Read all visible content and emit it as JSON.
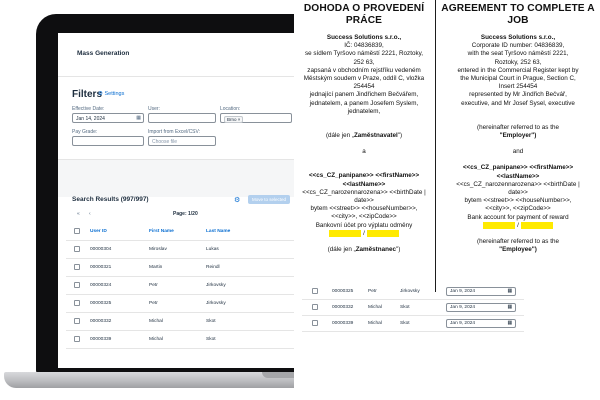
{
  "app": {
    "title": "Mass Generation",
    "filters_title": "Filters",
    "settings_label": "Settings",
    "fields": {
      "effective_date": {
        "label": "Effective Date:",
        "value": "Jan 14, 2024"
      },
      "user": {
        "label": "User:",
        "value": ""
      },
      "location": {
        "label": "Location:",
        "token": "Brno"
      },
      "pay_grade": {
        "label": "Pay Grade:",
        "value": ""
      },
      "import": {
        "label": "Import from Excel/CSV:",
        "placeholder": "Choose file"
      }
    },
    "results_title": "Search Results (997/997)",
    "move_button": "Move to selected",
    "pager": {
      "page_label": "Page: 1/20"
    },
    "table": {
      "columns": [
        "User ID",
        "First Name",
        "Last Name"
      ],
      "rows": [
        [
          "00000304",
          "Miroslav",
          "Lukas"
        ],
        [
          "00000321",
          "Martin",
          "Reindl"
        ],
        [
          "00000324",
          "Petr",
          "Jirkovsky"
        ],
        [
          "00000325",
          "Petr",
          "Jirkovsky"
        ],
        [
          "00000332",
          "Michal",
          "Skot"
        ],
        [
          "00000339",
          "Michal",
          "Skot"
        ]
      ]
    }
  },
  "document": {
    "cz": {
      "heading": "DOHODA O PROVEDENÍ PRÁCE",
      "company_name": "Success Solutions s.r.o.,",
      "company_lines": [
        "IČ: 04836839,",
        "se sídlem Tyršovo náměstí 2221, Roztoky,",
        "252 63,",
        "zapsaná v obchodním rejstříku vedeném",
        "Městským soudem v Praze, oddíl C, vložka",
        "254454",
        "jednající panem Jindřichem Bečvářem,",
        "jednatelem, a panem Josefem Syslem,",
        "jednatelem,"
      ],
      "employer_prefix": "(dále jen „",
      "employer_term": "Zaměstnavatel",
      "employer_suffix": "\")",
      "and": "a",
      "employee_names": "<<cs_CZ_panipane>> <<firstName>>",
      "employee_lastname": "<<lastName>>",
      "employee_born": "<<cs_CZ_narozennarozena>> <<birthDate |",
      "employee_date": "date>>",
      "employee_address": "bytem <<street>> <<houseNumber>>,",
      "employee_city": "<<city>>, <<zipCode>>",
      "bank_line": "Bankovní účet pro výplatu odměny",
      "slash": "/",
      "employee_ref_prefix": "(dále jen „",
      "employee_ref_term": "Zaměstnanec",
      "employee_ref_suffix": "\")"
    },
    "en": {
      "heading": "AGREEMENT TO COMPLETE A JOB",
      "company_name": "Success Solutions s.r.o.,",
      "company_lines": [
        "Corporate ID number: 04836839,",
        "with the seat Tyršovo náměstí 2221,",
        "Roztoky, 252 63,",
        "entered in the Commercial Register kept by",
        "the Municipal Court in Prague, Section C,",
        "Insert 254454",
        "represented by Mr Jindřich Bečvář,",
        "executive, and Mr Josef Sysel, executive"
      ],
      "employer_prefix": "(hereinafter referred to as the",
      "employer_term": "\"Employer\")",
      "and": "and",
      "employee_names": "<<cs_CZ_panipane>> <<firstName>>",
      "employee_lastname": "<<lastName>>",
      "employee_born": "<<cs_CZ_narozennarozena>> <<birthDate |",
      "employee_date": "date>>",
      "employee_address": "bytem <<street>> <<houseNumber>>,",
      "employee_city": "<<city>>, <<zipCode>>",
      "bank_line": "Bank account for payment of reward",
      "slash": "/",
      "employee_ref_prefix": "(hereinafter referred to as the",
      "employee_ref_term": "\"Employee\")"
    },
    "lower_table": {
      "rows": [
        [
          "00000325",
          "Petr",
          "Jirkovsky",
          "Jan 9, 2024"
        ],
        [
          "00000332",
          "Michal",
          "Skot",
          "Jan 9, 2024"
        ],
        [
          "00000339",
          "Michal",
          "Skot",
          "Jan 9, 2024"
        ]
      ]
    }
  },
  "colors": {
    "accent": "#0a6ed1",
    "highlight": "#ffea00",
    "laptop_bezel": "#0e0e10"
  }
}
